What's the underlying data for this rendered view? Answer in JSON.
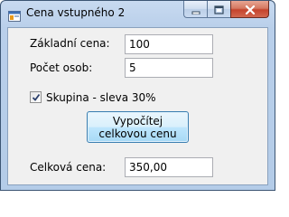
{
  "window": {
    "title": "Cena vstupného 2",
    "icon": "form-icon"
  },
  "caption": {
    "minimize_icon": "minimize-icon",
    "maximize_icon": "maximize-icon",
    "close_icon": "close-icon"
  },
  "form": {
    "base_price_label": "Základní cena:",
    "base_price_value": "100",
    "persons_label": "Počet osob:",
    "persons_value": "5",
    "group_checkbox_label": "Skupina - sleva 30%",
    "group_checked": true,
    "calculate_button": "Vypočítej celkovou cenu",
    "total_label": "Celková cena:",
    "total_value": "350,00"
  },
  "colors": {
    "accent": "#3c7fb1",
    "window_frame": "#b9cfea",
    "close_button": "#c5432c"
  }
}
